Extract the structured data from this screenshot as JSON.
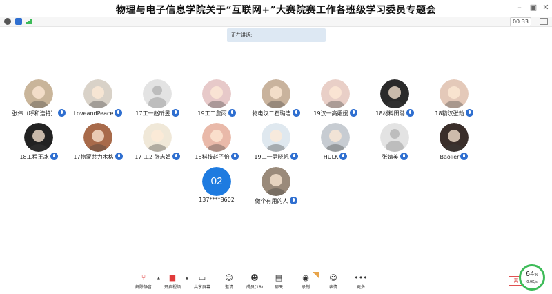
{
  "window": {
    "title": "物理与电子信息学院关于“互联网+”大赛院赛工作各班级学习委员专题会",
    "timer": "00:33",
    "controls": [
      "minimize-icon",
      "restore-icon",
      "close-icon"
    ]
  },
  "speaking": {
    "label": "正在讲话:"
  },
  "participants": [
    {
      "name": "张伟（呼和浩特）",
      "avatar": "photo",
      "mic": true
    },
    {
      "name": "LoveandPeace",
      "avatar": "photo",
      "mic": true
    },
    {
      "name": "17工一赵昕昱",
      "avatar": "default",
      "mic": true
    },
    {
      "name": "19工二詹雨",
      "avatar": "photo",
      "mic": true
    },
    {
      "name": "物电汉二石璐洁",
      "avatar": "photo",
      "mic": true
    },
    {
      "name": "19汉一高媛媛",
      "avatar": "photo",
      "mic": true
    },
    {
      "name": "18材料田璐",
      "avatar": "photo",
      "mic": true
    },
    {
      "name": "18物汉张劫",
      "avatar": "photo",
      "mic": true
    },
    {
      "name": "18工程王冰",
      "avatar": "photo",
      "mic": true
    },
    {
      "name": "17物蒙共力木格",
      "avatar": "photo",
      "mic": true
    },
    {
      "name": "17 工2 张志娟",
      "avatar": "photo",
      "mic": true
    },
    {
      "name": "18科技赵子怡",
      "avatar": "photo",
      "mic": true
    },
    {
      "name": "19工一尹晓帆",
      "avatar": "photo",
      "mic": true
    },
    {
      "name": "HULK",
      "avatar": "photo",
      "mic": true
    },
    {
      "name": "张婧英",
      "avatar": "default",
      "mic": true
    },
    {
      "name": "Baolier",
      "avatar": "photo",
      "mic": true
    },
    {
      "name": "137****8602",
      "avatar": "initials",
      "initials": "02",
      "mic": false
    },
    {
      "name": "做个有用的人",
      "avatar": "photo",
      "mic": true
    }
  ],
  "toolbar": {
    "unmute": "解除静音",
    "start_video": "开启视频",
    "share_screen": "共享屏幕",
    "invite": "邀请",
    "members": "成员(18)",
    "chat": "聊天",
    "record": "录制",
    "reactions": "表情",
    "more": "更多"
  },
  "network": {
    "percent": "64",
    "unit": "%",
    "speed": "0.9K/s"
  },
  "colors": {
    "accent": "#2f6fd0",
    "initials_bg": "#1e7be0",
    "network_ring": "#3dbb58",
    "speaking_bg": "#dde8f3"
  }
}
